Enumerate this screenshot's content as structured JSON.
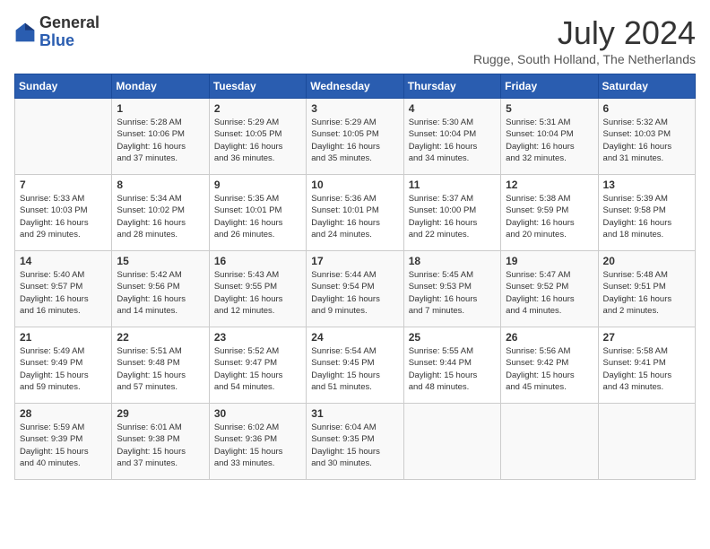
{
  "header": {
    "logo_general": "General",
    "logo_blue": "Blue",
    "month_title": "July 2024",
    "location": "Rugge, South Holland, The Netherlands"
  },
  "weekdays": [
    "Sunday",
    "Monday",
    "Tuesday",
    "Wednesday",
    "Thursday",
    "Friday",
    "Saturday"
  ],
  "weeks": [
    [
      {
        "day": "",
        "info": ""
      },
      {
        "day": "1",
        "info": "Sunrise: 5:28 AM\nSunset: 10:06 PM\nDaylight: 16 hours\nand 37 minutes."
      },
      {
        "day": "2",
        "info": "Sunrise: 5:29 AM\nSunset: 10:05 PM\nDaylight: 16 hours\nand 36 minutes."
      },
      {
        "day": "3",
        "info": "Sunrise: 5:29 AM\nSunset: 10:05 PM\nDaylight: 16 hours\nand 35 minutes."
      },
      {
        "day": "4",
        "info": "Sunrise: 5:30 AM\nSunset: 10:04 PM\nDaylight: 16 hours\nand 34 minutes."
      },
      {
        "day": "5",
        "info": "Sunrise: 5:31 AM\nSunset: 10:04 PM\nDaylight: 16 hours\nand 32 minutes."
      },
      {
        "day": "6",
        "info": "Sunrise: 5:32 AM\nSunset: 10:03 PM\nDaylight: 16 hours\nand 31 minutes."
      }
    ],
    [
      {
        "day": "7",
        "info": "Sunrise: 5:33 AM\nSunset: 10:03 PM\nDaylight: 16 hours\nand 29 minutes."
      },
      {
        "day": "8",
        "info": "Sunrise: 5:34 AM\nSunset: 10:02 PM\nDaylight: 16 hours\nand 28 minutes."
      },
      {
        "day": "9",
        "info": "Sunrise: 5:35 AM\nSunset: 10:01 PM\nDaylight: 16 hours\nand 26 minutes."
      },
      {
        "day": "10",
        "info": "Sunrise: 5:36 AM\nSunset: 10:01 PM\nDaylight: 16 hours\nand 24 minutes."
      },
      {
        "day": "11",
        "info": "Sunrise: 5:37 AM\nSunset: 10:00 PM\nDaylight: 16 hours\nand 22 minutes."
      },
      {
        "day": "12",
        "info": "Sunrise: 5:38 AM\nSunset: 9:59 PM\nDaylight: 16 hours\nand 20 minutes."
      },
      {
        "day": "13",
        "info": "Sunrise: 5:39 AM\nSunset: 9:58 PM\nDaylight: 16 hours\nand 18 minutes."
      }
    ],
    [
      {
        "day": "14",
        "info": "Sunrise: 5:40 AM\nSunset: 9:57 PM\nDaylight: 16 hours\nand 16 minutes."
      },
      {
        "day": "15",
        "info": "Sunrise: 5:42 AM\nSunset: 9:56 PM\nDaylight: 16 hours\nand 14 minutes."
      },
      {
        "day": "16",
        "info": "Sunrise: 5:43 AM\nSunset: 9:55 PM\nDaylight: 16 hours\nand 12 minutes."
      },
      {
        "day": "17",
        "info": "Sunrise: 5:44 AM\nSunset: 9:54 PM\nDaylight: 16 hours\nand 9 minutes."
      },
      {
        "day": "18",
        "info": "Sunrise: 5:45 AM\nSunset: 9:53 PM\nDaylight: 16 hours\nand 7 minutes."
      },
      {
        "day": "19",
        "info": "Sunrise: 5:47 AM\nSunset: 9:52 PM\nDaylight: 16 hours\nand 4 minutes."
      },
      {
        "day": "20",
        "info": "Sunrise: 5:48 AM\nSunset: 9:51 PM\nDaylight: 16 hours\nand 2 minutes."
      }
    ],
    [
      {
        "day": "21",
        "info": "Sunrise: 5:49 AM\nSunset: 9:49 PM\nDaylight: 15 hours\nand 59 minutes."
      },
      {
        "day": "22",
        "info": "Sunrise: 5:51 AM\nSunset: 9:48 PM\nDaylight: 15 hours\nand 57 minutes."
      },
      {
        "day": "23",
        "info": "Sunrise: 5:52 AM\nSunset: 9:47 PM\nDaylight: 15 hours\nand 54 minutes."
      },
      {
        "day": "24",
        "info": "Sunrise: 5:54 AM\nSunset: 9:45 PM\nDaylight: 15 hours\nand 51 minutes."
      },
      {
        "day": "25",
        "info": "Sunrise: 5:55 AM\nSunset: 9:44 PM\nDaylight: 15 hours\nand 48 minutes."
      },
      {
        "day": "26",
        "info": "Sunrise: 5:56 AM\nSunset: 9:42 PM\nDaylight: 15 hours\nand 45 minutes."
      },
      {
        "day": "27",
        "info": "Sunrise: 5:58 AM\nSunset: 9:41 PM\nDaylight: 15 hours\nand 43 minutes."
      }
    ],
    [
      {
        "day": "28",
        "info": "Sunrise: 5:59 AM\nSunset: 9:39 PM\nDaylight: 15 hours\nand 40 minutes."
      },
      {
        "day": "29",
        "info": "Sunrise: 6:01 AM\nSunset: 9:38 PM\nDaylight: 15 hours\nand 37 minutes."
      },
      {
        "day": "30",
        "info": "Sunrise: 6:02 AM\nSunset: 9:36 PM\nDaylight: 15 hours\nand 33 minutes."
      },
      {
        "day": "31",
        "info": "Sunrise: 6:04 AM\nSunset: 9:35 PM\nDaylight: 15 hours\nand 30 minutes."
      },
      {
        "day": "",
        "info": ""
      },
      {
        "day": "",
        "info": ""
      },
      {
        "day": "",
        "info": ""
      }
    ]
  ]
}
